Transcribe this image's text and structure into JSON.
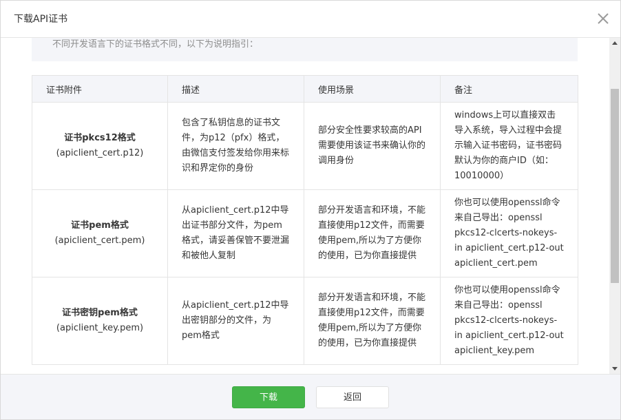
{
  "dialog": {
    "title": "下载API证书",
    "notice": "不同开发语言下的证书格式不同，以下为说明指引："
  },
  "table": {
    "headers": [
      "证书附件",
      "描述",
      "使用场景",
      "备注"
    ],
    "rows": [
      {
        "name": "证书pkcs12格式",
        "file": "(apiclient_cert.p12)",
        "description": "包含了私钥信息的证书文件，为p12（pfx）格式，由微信支付签发给你用来标识和界定你的身份",
        "usage": "部分安全性要求较高的API需要使用该证书来确认你的调用身份",
        "note": "windows上可以直接双击导入系统，导入过程中会提示输入证书密码，证书密码默认为你的商户ID（如：10010000）"
      },
      {
        "name": "证书pem格式",
        "file": "(apiclient_cert.pem)",
        "description": "从apiclient_cert.p12中导出证书部分文件，为pem格式，请妥善保管不要泄漏和被他人复制",
        "usage": "部分开发语言和环境，不能直接使用p12文件，而需要使用pem,所以为了方便你的使用，已为你直接提供",
        "note": "你也可以使用openssl命令来自己导出：openssl pkcs12-clcerts-nokeys-in apiclient_cert.p12-out apiclient_cert.pem"
      },
      {
        "name": "证书密钥pem格式",
        "file": "(apiclient_key.pem)",
        "description": "从apiclient_cert.p12中导出密钥部分的文件，为pem格式",
        "usage": "部分开发语言和环境，不能直接使用p12文件，而需要使用pem,所以为了方便你的使用，已为你直接提供",
        "note": "你也可以使用openssl命令来自己导出：openssl pkcs12-clcerts-nokeys-in apiclient_cert.p12-out apiclient_key.pem"
      }
    ]
  },
  "footer": {
    "download_label": "下载",
    "back_label": "返回"
  },
  "colors": {
    "primary": "#44b549",
    "header_bg": "#f4f5f9",
    "border": "#e4e4e4"
  },
  "icons": {
    "close": "close-icon",
    "scroll_up": "arrow-up-icon",
    "scroll_down": "arrow-down-icon"
  }
}
